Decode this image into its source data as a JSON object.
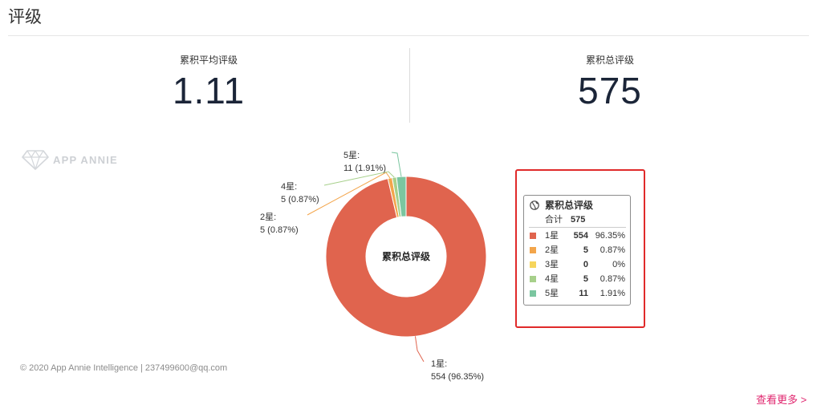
{
  "page": {
    "title": "评级"
  },
  "stats": {
    "average": {
      "label": "累积平均评级",
      "value": "1.11"
    },
    "total": {
      "label": "累积总评级",
      "value": "575"
    }
  },
  "watermark": {
    "icon": "app-annie-diamond-logo-icon",
    "text": "APP ANNIE"
  },
  "chart_data": {
    "type": "pie",
    "donut": true,
    "center_label": "累积总评级",
    "categories": [
      "1星",
      "2星",
      "3星",
      "4星",
      "5星"
    ],
    "values": [
      554,
      5,
      0,
      5,
      11
    ],
    "percentages": [
      96.35,
      0.87,
      0,
      0.87,
      1.91
    ],
    "colors": [
      "#E0644E",
      "#F3A54B",
      "#F6D55C",
      "#A7D08B",
      "#7BC6A0"
    ]
  },
  "tooltip": {
    "icon": "globe-icon",
    "title": "累积总评级",
    "total_label": "合计",
    "total_value": "575",
    "rows": [
      {
        "name": "1星",
        "count": "554",
        "percent": "96.35%"
      },
      {
        "name": "2星",
        "count": "5",
        "percent": "0.87%"
      },
      {
        "name": "3星",
        "count": "0",
        "percent": "0%"
      },
      {
        "name": "4星",
        "count": "5",
        "percent": "0.87%"
      },
      {
        "name": "5星",
        "count": "11",
        "percent": "1.91%"
      }
    ]
  },
  "footer": {
    "copyright": "© 2020 App Annie Intelligence | 237499600@qq.com"
  },
  "more_link": {
    "label": "查看更多 >"
  }
}
